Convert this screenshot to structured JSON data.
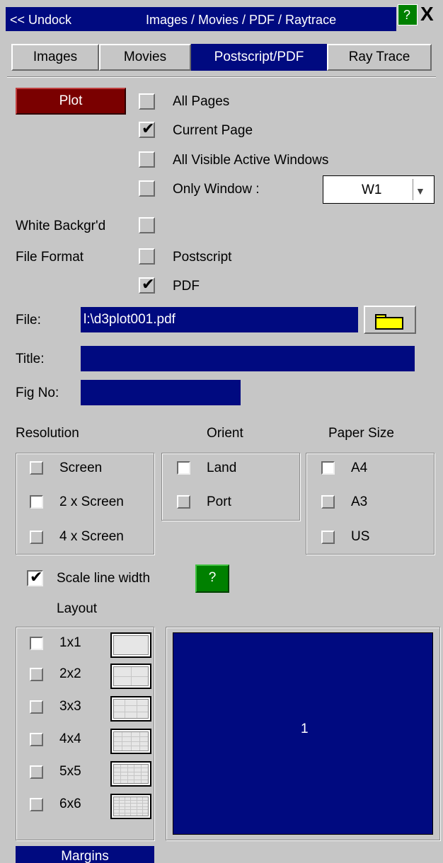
{
  "titlebar": {
    "undock": "<< Undock",
    "title": "Images / Movies / PDF / Raytrace",
    "help": "?",
    "close": "X"
  },
  "tabs": [
    {
      "label": "Images",
      "active": false
    },
    {
      "label": "Movies",
      "active": false
    },
    {
      "label": "Postscript/PDF",
      "active": true
    },
    {
      "label": "Ray Trace",
      "active": false
    }
  ],
  "plot_button": "Plot",
  "page_options": {
    "all_pages": "All Pages",
    "current_page": "Current Page",
    "all_visible": "All Visible Active Windows",
    "only_window": "Only Window :",
    "window_select": "W1"
  },
  "white_background": "White Backgr'd",
  "file_format": {
    "label": "File Format",
    "postscript": "Postscript",
    "pdf": "PDF"
  },
  "fields": {
    "file_label": "File:",
    "file_value": "l:\\d3plot001.pdf",
    "title_label": "Title:",
    "title_value": "",
    "figno_label": "Fig No:",
    "figno_value": ""
  },
  "resolution": {
    "header": "Resolution",
    "screen": "Screen",
    "x2": "2 x Screen",
    "x4": "4 x Screen"
  },
  "orient": {
    "header": "Orient",
    "land": "Land",
    "port": "Port"
  },
  "paper": {
    "header": "Paper Size",
    "a4": "A4",
    "a3": "A3",
    "us": "US"
  },
  "scale_line_width": "Scale line width",
  "scale_help": "?",
  "layout": {
    "header": "Layout",
    "items": [
      "1x1",
      "2x2",
      "3x3",
      "4x4",
      "5x5",
      "6x6"
    ],
    "preview_number": "1"
  },
  "margins_button": "Margins",
  "colors": {
    "panel": "#c6c6c6",
    "navy": "#000a80",
    "plot": "#7a0000",
    "help_green": "#008000",
    "folder": "#ffff00"
  }
}
